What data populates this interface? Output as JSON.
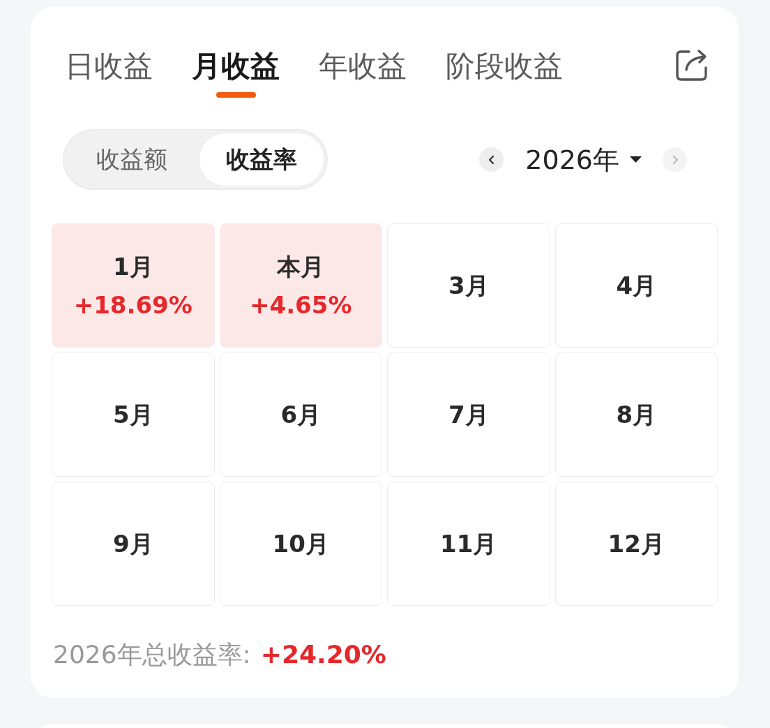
{
  "tabs": [
    {
      "label": "日收益",
      "selected": false
    },
    {
      "label": "月收益",
      "selected": true
    },
    {
      "label": "年收益",
      "selected": false
    },
    {
      "label": "阶段收益",
      "selected": false
    }
  ],
  "mode_toggle": [
    {
      "label": "收益额",
      "selected": false
    },
    {
      "label": "收益率",
      "selected": true
    }
  ],
  "year_nav": {
    "year": "2026年",
    "prev_disabled": false,
    "next_disabled": true
  },
  "months": [
    {
      "label": "1月",
      "value": "+18.69%",
      "highlighted": true
    },
    {
      "label": "本月",
      "value": "+4.65%",
      "highlighted": true
    },
    {
      "label": "3月",
      "highlighted": false
    },
    {
      "label": "4月",
      "highlighted": false
    },
    {
      "label": "5月",
      "highlighted": false
    },
    {
      "label": "6月",
      "highlighted": false
    },
    {
      "label": "7月",
      "highlighted": false
    },
    {
      "label": "8月",
      "highlighted": false
    },
    {
      "label": "9月",
      "highlighted": false
    },
    {
      "label": "10月",
      "highlighted": false
    },
    {
      "label": "11月",
      "highlighted": false
    },
    {
      "label": "12月",
      "highlighted": false
    }
  ],
  "summary": {
    "label": "2026年总收益率:",
    "value": "+24.20%"
  }
}
